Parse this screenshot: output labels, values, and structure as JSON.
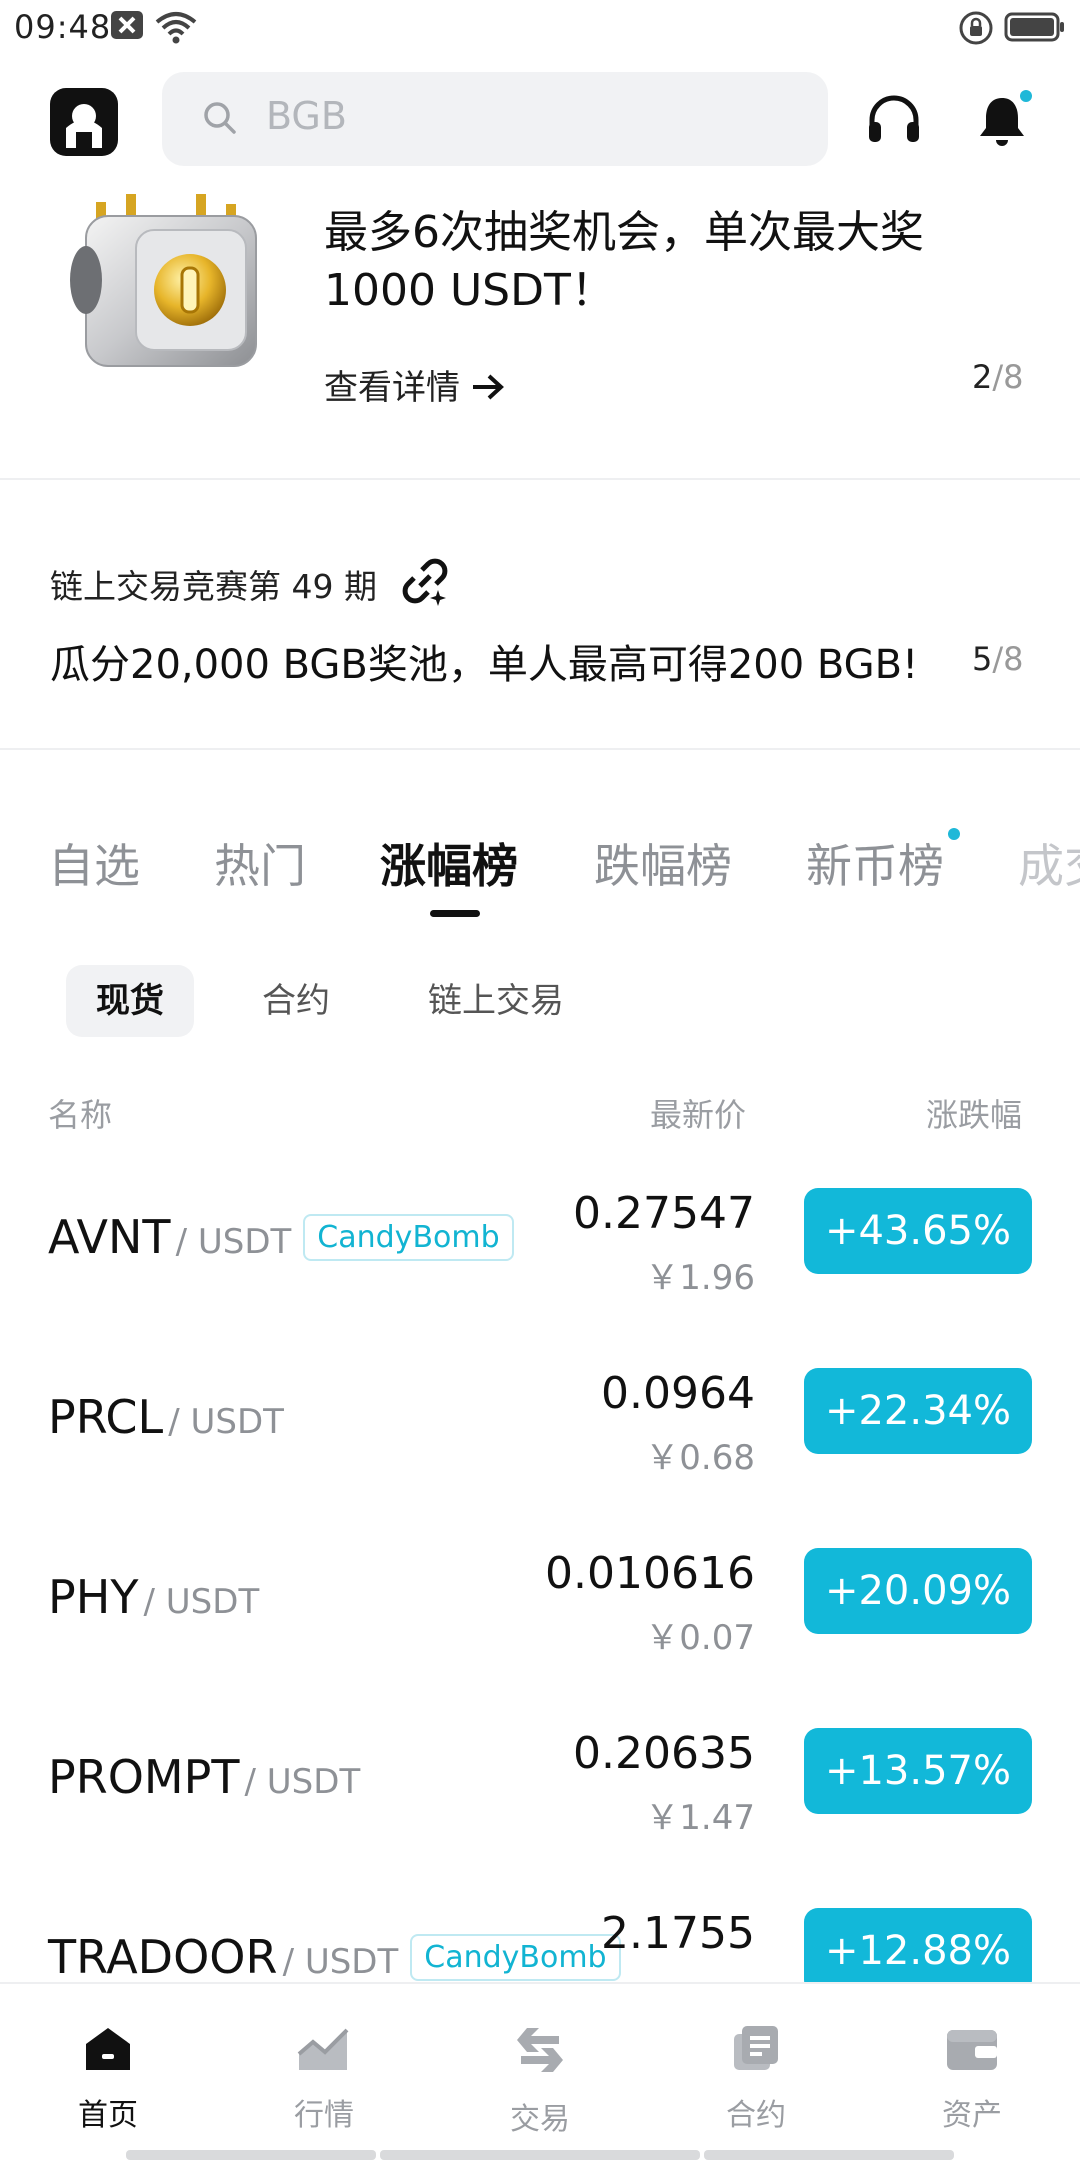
{
  "status_bar": {
    "time": "09:48"
  },
  "colors": {
    "accent": "#12b8d9",
    "notification_dot": "#1fb8d8",
    "tab_active": "#111111"
  },
  "header": {
    "search_placeholder": "BGB",
    "icons": [
      "app-logo",
      "search-icon",
      "headset-icon",
      "bell-icon"
    ]
  },
  "banner1": {
    "title": "最多6次抽奖机会，单次最大奖1000 USDT！",
    "link": "查看详情",
    "page_current": "2",
    "page_total": "/8"
  },
  "banner2": {
    "title": "链上交易竞赛第 49 期",
    "text": "瓜分20,000 BGB奖池，单人最高可得200 BGB!",
    "page_current": "5",
    "page_total": "/8"
  },
  "tabs": [
    "自选",
    "热门",
    "涨幅榜",
    "跌幅榜",
    "新币榜",
    "成交"
  ],
  "active_tab": "涨幅榜",
  "subtabs": [
    "现货",
    "合约",
    "链上交易"
  ],
  "columns": {
    "name": "名称",
    "price": "最新价",
    "change": "涨跌幅"
  },
  "rows": [
    {
      "base": "AVNT",
      "quote": "/ USDT",
      "tag": "CandyBomb",
      "price": "0.27547",
      "fiat": "￥1.96",
      "change": "+43.65%"
    },
    {
      "base": "PRCL",
      "quote": "/ USDT",
      "tag": "",
      "price": "0.0964",
      "fiat": "￥0.68",
      "change": "+22.34%"
    },
    {
      "base": "PHY",
      "quote": "/ USDT",
      "tag": "",
      "price": "0.010616",
      "fiat": "￥0.07",
      "change": "+20.09%"
    },
    {
      "base": "PROMPT",
      "quote": "/ USDT",
      "tag": "",
      "price": "0.20635",
      "fiat": "￥1.47",
      "change": "+13.57%"
    },
    {
      "base": "TRADOOR",
      "quote": "/ USDT",
      "tag": "CandyBomb",
      "price": "2.1755",
      "fiat": "",
      "change": "+12.88%"
    }
  ],
  "bottom_nav": [
    {
      "label": "首页",
      "icon": "home-icon"
    },
    {
      "label": "行情",
      "icon": "chart-icon"
    },
    {
      "label": "交易",
      "icon": "exchange-icon"
    },
    {
      "label": "合约",
      "icon": "contract-icon"
    },
    {
      "label": "资产",
      "icon": "wallet-icon"
    }
  ]
}
